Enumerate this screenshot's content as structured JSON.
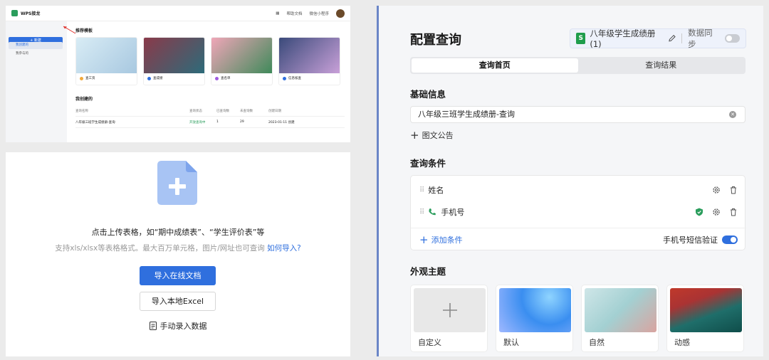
{
  "app": {
    "brand": "WPS接龙",
    "top_tools": [
      "帮助文档",
      "微信小程序"
    ],
    "new_button": "+ 新建",
    "sidebar": [
      "我创建的",
      "我参与的"
    ],
    "recommended_title": "推荐模板",
    "templates": [
      {
        "label": "查工资",
        "color": "#f2a93b"
      },
      {
        "label": "查成绩",
        "color": "#2f6fde"
      },
      {
        "label": "查名单",
        "color": "#a05be0"
      },
      {
        "label": "信息核查",
        "color": "#2f6fde"
      }
    ],
    "mine_title": "我创建的",
    "table": {
      "headers": [
        "查询名称",
        "查询状态",
        "已查询数",
        "未查询数",
        "创建日期"
      ],
      "rows": [
        [
          "八年级三班学生成绩册-查询",
          "开放查询中",
          "1",
          "29",
          "2023-01-11 创建"
        ]
      ]
    }
  },
  "import_panel": {
    "hint_main": "点击上传表格，如“期中成绩表”、“学生评价表”等",
    "hint_sub": "支持xls/xlsx等表格格式。最大百万单元格，图片/网址也可查询",
    "hint_link": "如何导入?",
    "btn_online": "导入在线文档",
    "btn_local": "导入本地Excel",
    "manual": "手动录入数据"
  },
  "config": {
    "title": "配置查询",
    "file_chip": {
      "sheet_letter": "S",
      "name": "八年级学生成绩册(1)",
      "sync_label": "数据同步",
      "sync_on": false
    },
    "tabs": [
      {
        "label": "查询首页",
        "active": true
      },
      {
        "label": "查询结果",
        "active": false
      }
    ],
    "basic_title": "基础信息",
    "query_name": "八年级三班学生成绩册-查询",
    "add_notice": "图文公告",
    "cond_title": "查询条件",
    "conditions": [
      {
        "label": "姓名"
      },
      {
        "label": "手机号"
      }
    ],
    "add_condition": "添加条件",
    "sms_label": "手机号短信验证",
    "sms_on": true,
    "theme_title": "外观主题",
    "themes": [
      {
        "label": "自定义"
      },
      {
        "label": "默认"
      },
      {
        "label": "自然"
      },
      {
        "label": "动感"
      }
    ]
  },
  "colors": {
    "accent": "#2f6fde",
    "sheet_green": "#1f9d4c",
    "shield_green": "#2a9d5c"
  }
}
